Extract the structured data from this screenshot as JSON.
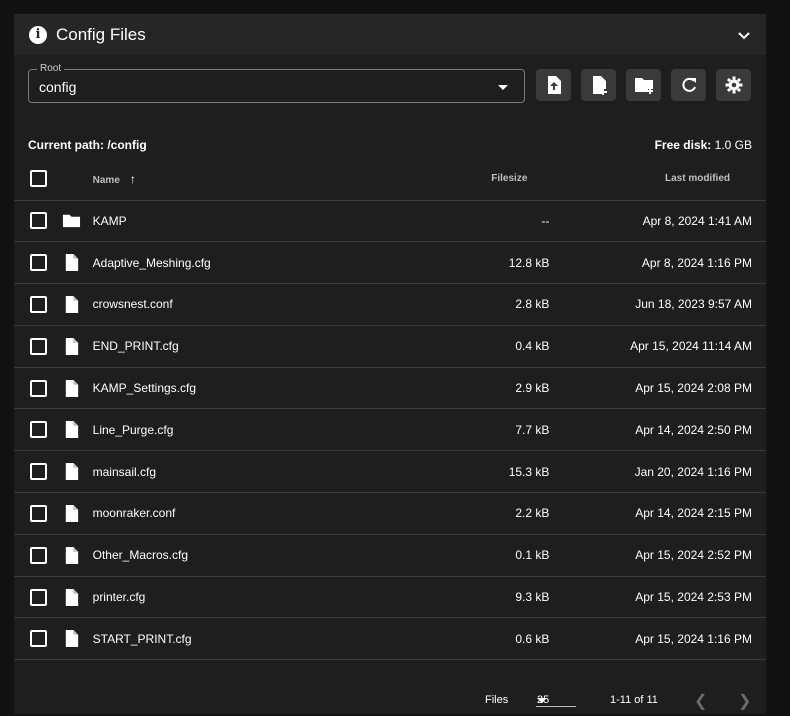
{
  "header": {
    "title": "Config Files",
    "info_icon": "info-icon",
    "collapse_icon": "chevron-down-icon"
  },
  "toolbar": {
    "root_label": "Root",
    "root_value": "config",
    "buttons": [
      "upload-file-icon",
      "new-file-icon",
      "new-folder-icon",
      "refresh-icon",
      "settings-icon"
    ]
  },
  "path": {
    "current_label": "Current path: /config",
    "free_disk_label": "Free disk:",
    "free_disk_value": "1.0 GB"
  },
  "table": {
    "headers": {
      "name": "Name",
      "filesize": "Filesize",
      "modified": "Last modified"
    },
    "rows": [
      {
        "type": "folder",
        "name": "KAMP",
        "size": "--",
        "modified": "Apr 8, 2024 1:41 AM"
      },
      {
        "type": "file",
        "name": "Adaptive_Meshing.cfg",
        "size": "12.8 kB",
        "modified": "Apr 8, 2024 1:16 PM"
      },
      {
        "type": "file",
        "name": "crowsnest.conf",
        "size": "2.8 kB",
        "modified": "Jun 18, 2023 9:57 AM"
      },
      {
        "type": "file",
        "name": "END_PRINT.cfg",
        "size": "0.4 kB",
        "modified": "Apr 15, 2024 11:14 AM"
      },
      {
        "type": "file",
        "name": "KAMP_Settings.cfg",
        "size": "2.9 kB",
        "modified": "Apr 15, 2024 2:08 PM"
      },
      {
        "type": "file",
        "name": "Line_Purge.cfg",
        "size": "7.7 kB",
        "modified": "Apr 14, 2024 2:50 PM"
      },
      {
        "type": "file",
        "name": "mainsail.cfg",
        "size": "15.3 kB",
        "modified": "Jan 20, 2024 1:16 PM"
      },
      {
        "type": "file",
        "name": "moonraker.conf",
        "size": "2.2 kB",
        "modified": "Apr 14, 2024 2:15 PM"
      },
      {
        "type": "file",
        "name": "Other_Macros.cfg",
        "size": "0.1 kB",
        "modified": "Apr 15, 2024 2:52 PM"
      },
      {
        "type": "file",
        "name": "printer.cfg",
        "size": "9.3 kB",
        "modified": "Apr 15, 2024 2:53 PM"
      },
      {
        "type": "file",
        "name": "START_PRINT.cfg",
        "size": "0.6 kB",
        "modified": "Apr 15, 2024 1:16 PM"
      }
    ]
  },
  "footer": {
    "files_label": "Files",
    "per_page": "25",
    "range": "1-11 of 11"
  },
  "colors": {
    "background": "#121212",
    "card": "#1e1e1e",
    "header": "#262626",
    "button": "#3a3a3a"
  }
}
